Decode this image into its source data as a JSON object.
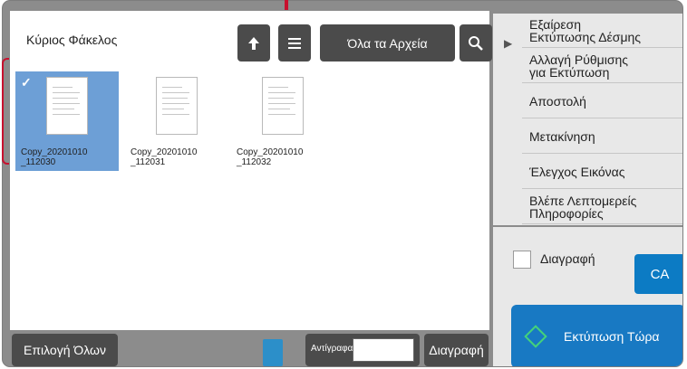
{
  "colors": {
    "accent_blue": "#1879c3",
    "selection_blue": "#6d9fd6",
    "dark_button": "#4b4b4b",
    "callout_red": "#c8102e",
    "print_icon_green": "#44d27a"
  },
  "header": {
    "folder_title": "Κύριος Φάκελος",
    "all_files_label": "Όλα τα Αρχεία",
    "icons": {
      "up": "up-arrow-icon",
      "list": "list-view-icon",
      "search": "search-icon"
    }
  },
  "files": [
    {
      "name_line1": "Copy_20201010",
      "name_line2": "_112030",
      "selected": true
    },
    {
      "name_line1": "Copy_20201010",
      "name_line2": "_112031",
      "selected": false
    },
    {
      "name_line1": "Copy_20201010",
      "name_line2": "_112032",
      "selected": false
    }
  ],
  "bottom": {
    "select_all_label": "Επιλογή Όλων",
    "copies_label": "Αντίγραφα",
    "copies_value": "",
    "delete_label": "Διαγραφή"
  },
  "menu": {
    "items": [
      {
        "line1": "Εξαίρεση",
        "line2": "Εκτύπωσης Δέσμης"
      },
      {
        "line1": "Αλλαγή Ρύθμισης",
        "line2": "για Εκτύπωση"
      },
      {
        "line1": "Αποστολή",
        "line2": ""
      },
      {
        "line1": "Μετακίνηση",
        "line2": ""
      },
      {
        "line1": "Έλεγχος Εικόνας",
        "line2": ""
      },
      {
        "line1": "Βλέπε Λεπτομερείς",
        "line2": "Πληροφορίες"
      }
    ]
  },
  "panel": {
    "delete_checkbox_label": "Διαγραφή",
    "ca_label": "CA",
    "print_now_label": "Εκτύπωση Τώρα"
  }
}
